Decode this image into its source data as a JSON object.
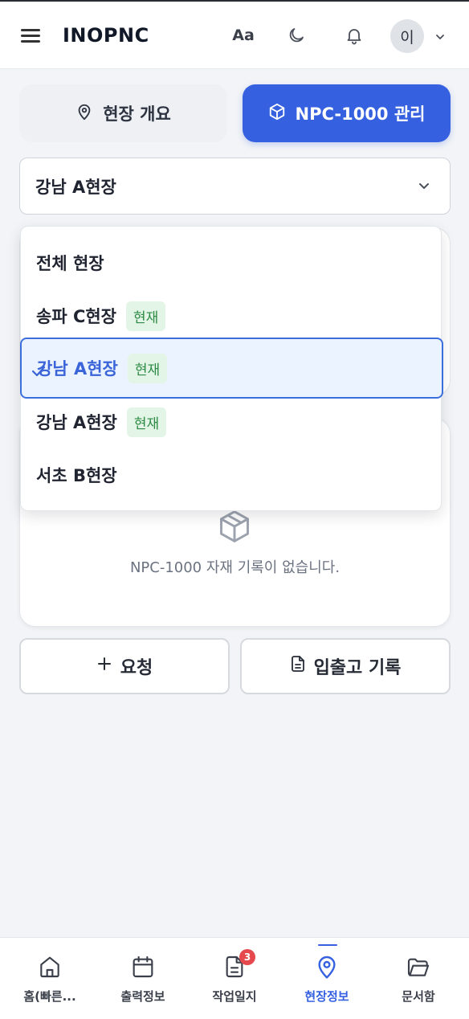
{
  "header": {
    "brand": "INOPNC",
    "font_size_label": "Aa",
    "avatar_initial": "이"
  },
  "tabs": [
    {
      "label": "현장 개요",
      "icon": "map-pin-icon",
      "active": false
    },
    {
      "label": "NPC-1000 관리",
      "icon": "package-icon",
      "active": true
    }
  ],
  "site_select": {
    "value": "강남 A현장"
  },
  "dropdown": {
    "options": [
      {
        "label": "전체 현장",
        "badge": "",
        "selected": false
      },
      {
        "label": "송파 C현장",
        "badge": "현재",
        "selected": false
      },
      {
        "label": "강남 A현장",
        "badge": "현재",
        "selected": true
      },
      {
        "label": "강남 A현장",
        "badge": "현재",
        "selected": false
      },
      {
        "label": "서초 B현장",
        "badge": "",
        "selected": false
      }
    ]
  },
  "empty_state": {
    "icon": "package-icon",
    "message": "NPC-1000 자재 기록이 없습니다."
  },
  "actions": {
    "request_label": "요청",
    "log_label": "입출고 기록"
  },
  "bottom_nav": {
    "items": [
      {
        "label": "홈(빠른...",
        "icon": "home-icon"
      },
      {
        "label": "출력정보",
        "icon": "calendar-icon"
      },
      {
        "label": "작업일지",
        "icon": "document-icon",
        "badge": "3"
      },
      {
        "label": "현장정보",
        "icon": "map-pin-icon",
        "active": true
      },
      {
        "label": "문서함",
        "icon": "folder-icon"
      }
    ]
  },
  "colors": {
    "accent": "#3560e0",
    "badge_bg": "#e3f5e6",
    "badge_text": "#2d8a45",
    "notification": "#e5484d"
  }
}
